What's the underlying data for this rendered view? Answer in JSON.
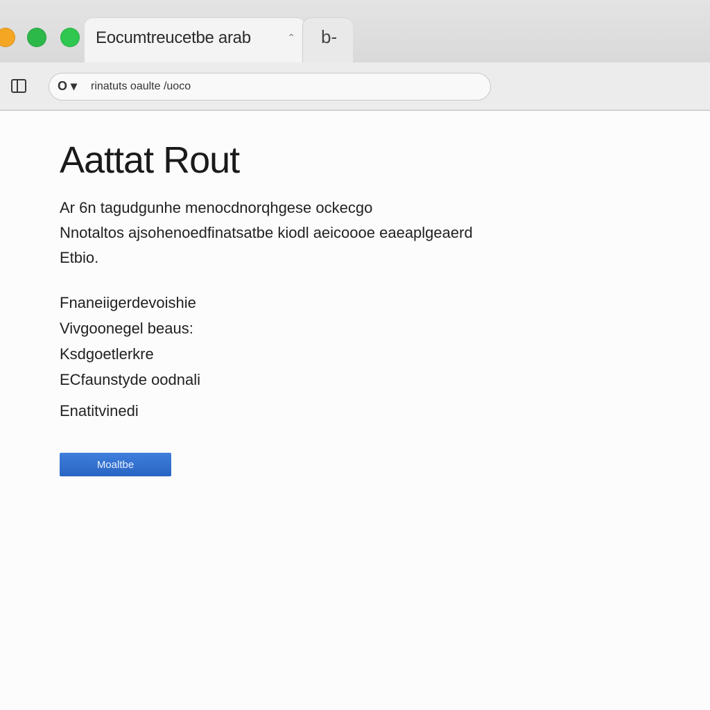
{
  "window": {
    "traffic_lights": {
      "close_color": "#f5a623",
      "minimize_color": "#2db84a",
      "maximize_color": "#2fc74f"
    }
  },
  "tabs": [
    {
      "label": "Eocumtreucetbe arab",
      "close_symbol": "⌃",
      "active": true
    },
    {
      "label": "",
      "icon": "b-",
      "active": false
    }
  ],
  "toolbar": {
    "sidebar_icon": "sidebar-icon",
    "address": {
      "lock_symbol": "O ▾",
      "url": "rinatuts oaulte /uoco"
    }
  },
  "page": {
    "title": "Aattat Rout",
    "intro_lines": [
      "Ar 6n tagudgunhe menocdnorqhgese ockecgo",
      "Nnotaltos ajsohenoedfinatsatbe kiodl aeicoooe eaeaplgeaerd",
      "Etbio."
    ],
    "features": [
      "Fnaneiigerdevoishie",
      "Vivgoonegel beaus:",
      "Ksdgoetlerkre",
      "ECfaunstyde oodnali"
    ],
    "extra_line": "Enatitvinedi",
    "button_label": "Moaltbe",
    "accent_color": "#2a64c3"
  }
}
